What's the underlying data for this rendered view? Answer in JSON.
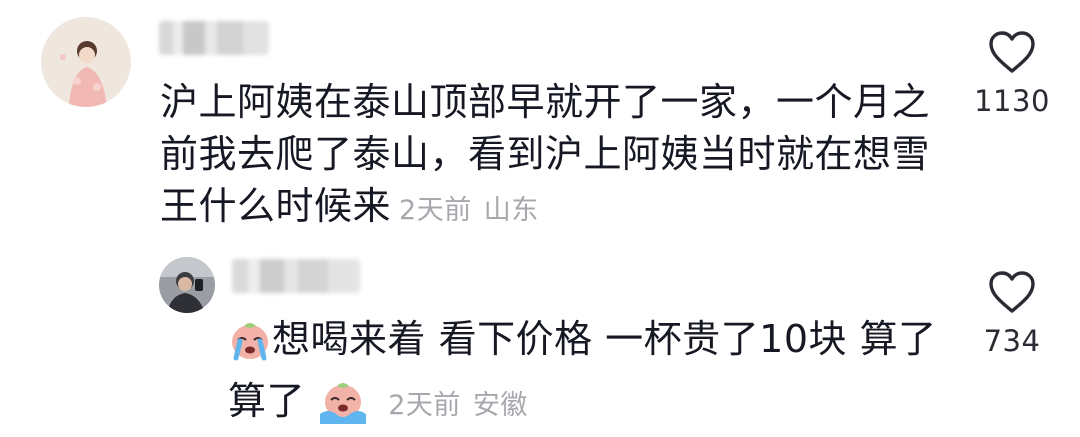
{
  "comments": [
    {
      "text_lines": [
        "沪上阿姨在泰山顶部早就开了一家，一个月之",
        "前我去爬了泰山，看到沪上阿姨当时就在想雪",
        "王什么时候来"
      ],
      "time": "2天前",
      "location": "山东",
      "likes": "1130"
    },
    {
      "text_line1": "想喝来着 看下价格 一杯贵了10块 算了",
      "text_line2": "算了",
      "time": "2天前",
      "location": "安徽",
      "likes": "734"
    }
  ],
  "icons": {
    "like": "heart-outline-icon",
    "emoji_crying": "crying-face-emoji-icon"
  },
  "colors": {
    "text": "#161823",
    "meta": "#a7a8ad",
    "icon": "#2b2c33"
  }
}
